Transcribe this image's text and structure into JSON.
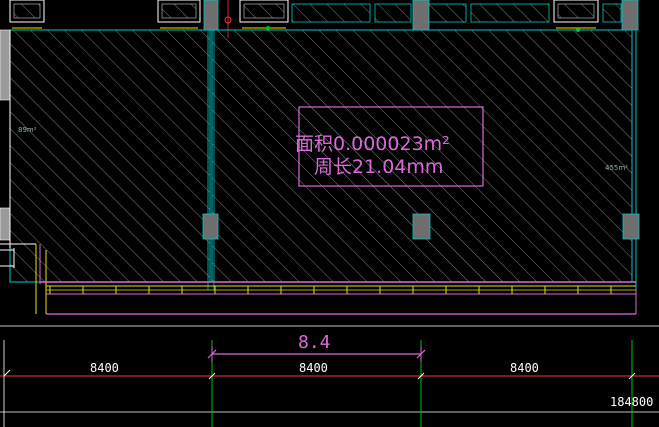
{
  "drawing": {
    "area_label": "面积0.000023m²",
    "perimeter_label": "周长21.04mm",
    "room_area_left": "89m²",
    "room_area_right": "455m²",
    "magenta_dimension": "8.4",
    "bay_dimensions": [
      "8400",
      "8400",
      "8400"
    ],
    "total_dimension": "184800"
  },
  "colors": {
    "background": "#000000",
    "hatch": "#8c8c8c",
    "wall_cyan": "#00c8c8",
    "magenta": "#d86bd8",
    "yellow": "#e6e600",
    "green": "#00c000",
    "white": "#ffffff"
  }
}
